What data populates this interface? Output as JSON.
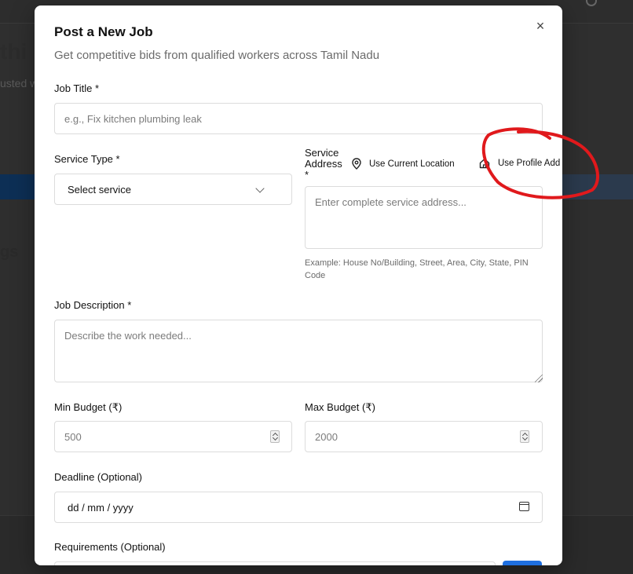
{
  "background": {
    "heading_fragment": "thi",
    "sub_fragment": "usted w",
    "section_fragment": "gs"
  },
  "modal": {
    "title": "Post a New Job",
    "subtitle": "Get competitive bids from qualified workers across Tamil Nadu",
    "close_glyph": "×"
  },
  "form": {
    "job_title": {
      "label": "Job Title *",
      "placeholder": "e.g., Fix kitchen plumbing leak"
    },
    "service_type": {
      "label": "Service Type *",
      "value": "Select service"
    },
    "service_address": {
      "label_line1": "Service",
      "label_line2": "Address",
      "label_line3": "*",
      "use_current_location": "Use Current Location",
      "use_profile_address": "Use Profile Add",
      "placeholder": "Enter complete service address...",
      "hint": "Example: House No/Building, Street, Area, City, State, PIN Code"
    },
    "job_description": {
      "label": "Job Description *",
      "placeholder": "Describe the work needed..."
    },
    "min_budget": {
      "label": "Min Budget (₹)",
      "placeholder": "500"
    },
    "max_budget": {
      "label": "Max Budget (₹)",
      "placeholder": "2000"
    },
    "deadline": {
      "label": "Deadline (Optional)",
      "value": "dd / mm / yyyy"
    },
    "requirements": {
      "label": "Requirements (Optional)"
    }
  },
  "annotation": {
    "color": "#e0191c"
  }
}
